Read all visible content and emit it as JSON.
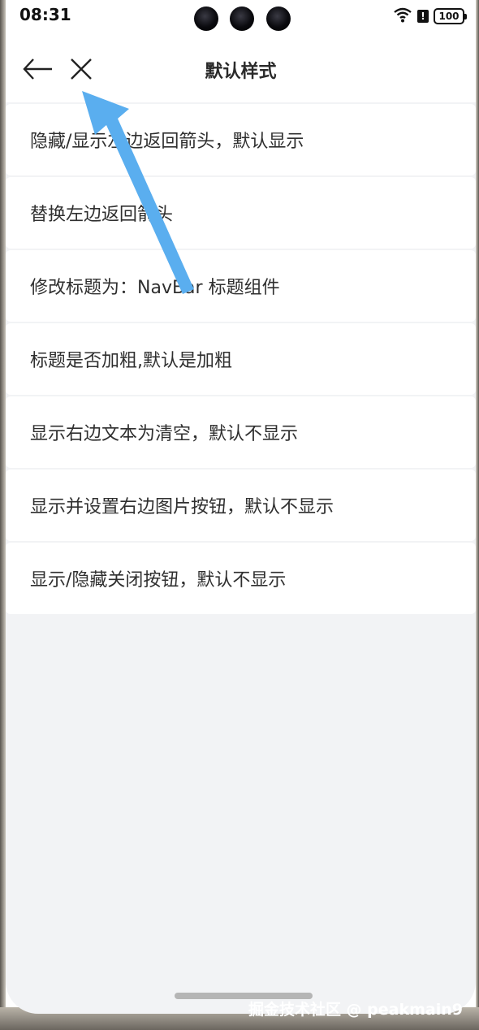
{
  "status_bar": {
    "time": "08:31",
    "alert_glyph": "!",
    "battery": "100",
    "icons": [
      "wifi-icon",
      "alert-icon",
      "battery-icon"
    ]
  },
  "nav_bar": {
    "title": "默认样式",
    "back_icon": "arrow-left-icon",
    "close_icon": "close-icon"
  },
  "list_items": [
    "隐藏/显示左边返回箭头，默认显示",
    "替换左边返回箭头",
    "修改标题为：NavBar 标题组件",
    "标题是否加粗,默认是加粗",
    "显示右边文本为清空，默认不显示",
    "显示并设置右边图片按钮，默认不显示",
    "显示/隐藏关闭按钮，默认不显示"
  ],
  "annotation": {
    "arrow_color": "#5aaeef"
  },
  "watermark": "掘金技术社区 @ peakmain9",
  "colors": {
    "background": "#f2f3f5",
    "card": "#ffffff",
    "text": "#2f2f2f"
  }
}
